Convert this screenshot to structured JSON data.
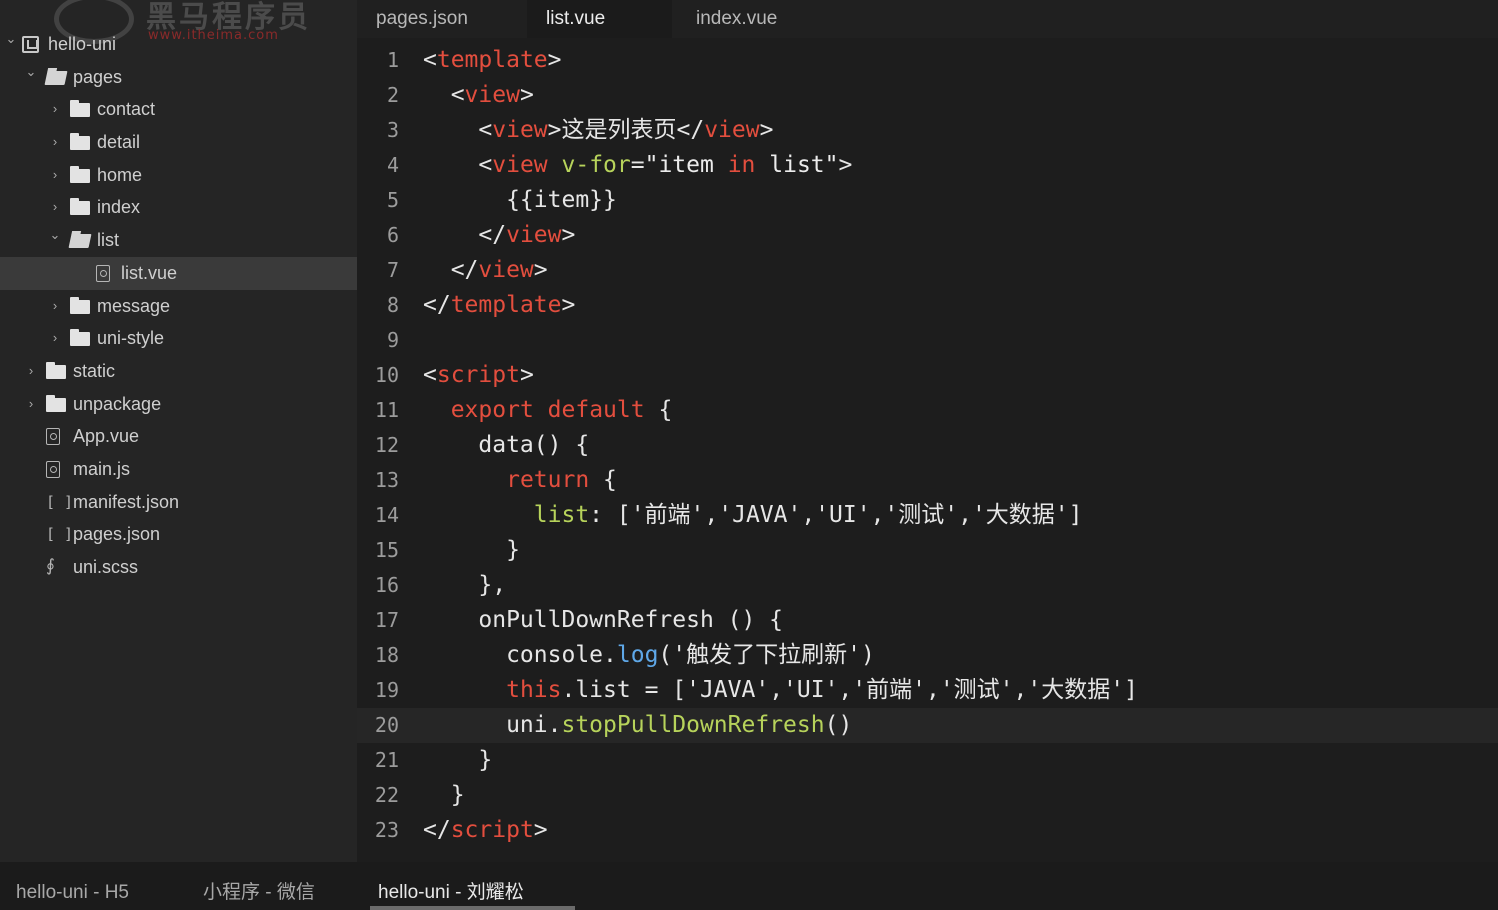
{
  "watermark": {
    "brand": "黑马程序员",
    "url": "www.itheima.com"
  },
  "sidebar": {
    "items": [
      {
        "label": "hello-uni",
        "type": "project",
        "depth": 0,
        "expanded": true
      },
      {
        "label": "pages",
        "type": "folder",
        "depth": 1,
        "expanded": true
      },
      {
        "label": "contact",
        "type": "folder",
        "depth": 2,
        "expanded": false
      },
      {
        "label": "detail",
        "type": "folder",
        "depth": 2,
        "expanded": false
      },
      {
        "label": "home",
        "type": "folder",
        "depth": 2,
        "expanded": false
      },
      {
        "label": "index",
        "type": "folder",
        "depth": 2,
        "expanded": false
      },
      {
        "label": "list",
        "type": "folder",
        "depth": 2,
        "expanded": true
      },
      {
        "label": "list.vue",
        "type": "file",
        "depth": 3,
        "selected": true
      },
      {
        "label": "message",
        "type": "folder",
        "depth": 2,
        "expanded": false
      },
      {
        "label": "uni-style",
        "type": "folder",
        "depth": 2,
        "expanded": false
      },
      {
        "label": "static",
        "type": "folder",
        "depth": 1,
        "expanded": false
      },
      {
        "label": "unpackage",
        "type": "folder",
        "depth": 1,
        "expanded": false
      },
      {
        "label": "App.vue",
        "type": "file",
        "depth": 1
      },
      {
        "label": "main.js",
        "type": "file",
        "depth": 1
      },
      {
        "label": "manifest.json",
        "type": "json",
        "depth": 1
      },
      {
        "label": "pages.json",
        "type": "json",
        "depth": 1
      },
      {
        "label": "uni.scss",
        "type": "scss",
        "depth": 1
      }
    ]
  },
  "tabs": [
    {
      "label": "pages.json",
      "active": false
    },
    {
      "label": "list.vue",
      "active": true
    },
    {
      "label": "index.vue",
      "active": false
    }
  ],
  "editor": {
    "current_line": 20,
    "lines": [
      {
        "n": "1",
        "tokens": [
          [
            "punc",
            "<"
          ],
          [
            "tag",
            "template"
          ],
          [
            "punc",
            ">"
          ]
        ]
      },
      {
        "n": "2",
        "tokens": [
          [
            "punc",
            "  <"
          ],
          [
            "tag",
            "view"
          ],
          [
            "punc",
            ">"
          ]
        ]
      },
      {
        "n": "3",
        "tokens": [
          [
            "punc",
            "    <"
          ],
          [
            "tag",
            "view"
          ],
          [
            "punc",
            ">这是列表页</"
          ],
          [
            "tag",
            "view"
          ],
          [
            "punc",
            ">"
          ]
        ]
      },
      {
        "n": "4",
        "tokens": [
          [
            "punc",
            "    <"
          ],
          [
            "tag",
            "view"
          ],
          [
            "punc",
            " "
          ],
          [
            "attr",
            "v-for"
          ],
          [
            "punc",
            "="
          ],
          [
            "str",
            "\"item "
          ],
          [
            "kw",
            "in"
          ],
          [
            "str",
            " list\""
          ],
          [
            "punc",
            ">"
          ]
        ]
      },
      {
        "n": "5",
        "tokens": [
          [
            "punc",
            "      {{item}}"
          ]
        ]
      },
      {
        "n": "6",
        "tokens": [
          [
            "punc",
            "    </"
          ],
          [
            "tag",
            "view"
          ],
          [
            "punc",
            ">"
          ]
        ]
      },
      {
        "n": "7",
        "tokens": [
          [
            "punc",
            "  </"
          ],
          [
            "tag",
            "view"
          ],
          [
            "punc",
            ">"
          ]
        ]
      },
      {
        "n": "8",
        "tokens": [
          [
            "punc",
            "</"
          ],
          [
            "tag",
            "template"
          ],
          [
            "punc",
            ">"
          ]
        ]
      },
      {
        "n": "9",
        "tokens": []
      },
      {
        "n": "10",
        "tokens": [
          [
            "punc",
            "<"
          ],
          [
            "tag",
            "script"
          ],
          [
            "punc",
            ">"
          ]
        ]
      },
      {
        "n": "11",
        "tokens": [
          [
            "punc",
            "  "
          ],
          [
            "kw",
            "export"
          ],
          [
            "punc",
            " "
          ],
          [
            "kw",
            "default"
          ],
          [
            "punc",
            " {"
          ]
        ]
      },
      {
        "n": "12",
        "tokens": [
          [
            "punc",
            "    data() {"
          ]
        ]
      },
      {
        "n": "13",
        "tokens": [
          [
            "punc",
            "      "
          ],
          [
            "kw",
            "return"
          ],
          [
            "punc",
            " {"
          ]
        ]
      },
      {
        "n": "14",
        "tokens": [
          [
            "attr",
            "        list"
          ],
          [
            "punc",
            ": ['前端','JAVA','UI','测试','大数据']"
          ]
        ]
      },
      {
        "n": "15",
        "tokens": [
          [
            "punc",
            "      }"
          ]
        ]
      },
      {
        "n": "16",
        "tokens": [
          [
            "punc",
            "    },"
          ]
        ]
      },
      {
        "n": "17",
        "tokens": [
          [
            "punc",
            "    onPullDownRefresh () {"
          ]
        ]
      },
      {
        "n": "18",
        "tokens": [
          [
            "punc",
            "      console"
          ],
          [
            "punc",
            "."
          ],
          [
            "fn",
            "log"
          ],
          [
            "punc",
            "('触发了下拉刷新')"
          ]
        ]
      },
      {
        "n": "19",
        "tokens": [
          [
            "punc",
            "      "
          ],
          [
            "kw",
            "this"
          ],
          [
            "punc",
            ".list = ['JAVA','UI','前端','测试','大数据']"
          ]
        ]
      },
      {
        "n": "20",
        "tokens": [
          [
            "punc",
            "      uni"
          ],
          [
            "punc",
            "."
          ],
          [
            "attr",
            "stopPullDownRefresh"
          ],
          [
            "punc",
            "()"
          ]
        ]
      },
      {
        "n": "21",
        "tokens": [
          [
            "punc",
            "    }"
          ]
        ]
      },
      {
        "n": "22",
        "tokens": [
          [
            "punc",
            "  }"
          ]
        ]
      },
      {
        "n": "23",
        "tokens": [
          [
            "punc",
            "</"
          ],
          [
            "tag",
            "script"
          ],
          [
            "punc",
            ">"
          ]
        ]
      }
    ]
  },
  "statusbar": {
    "items": [
      {
        "label": "hello-uni - H5",
        "active": false
      },
      {
        "label": "小程序 - 微信",
        "active": false
      },
      {
        "label": "hello-uni - 刘耀松",
        "active": true
      }
    ]
  }
}
